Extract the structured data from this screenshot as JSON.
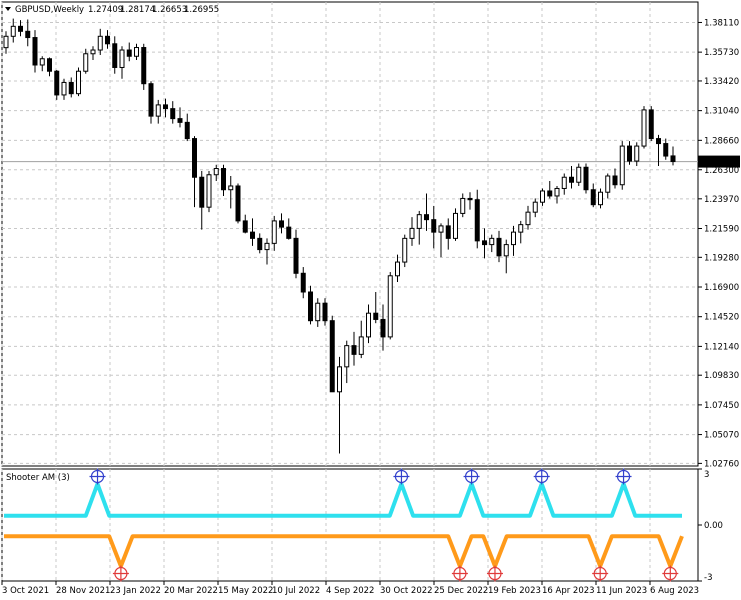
{
  "chart_data": [
    {
      "type": "candlestick",
      "title": "GBPUSD,Weekly",
      "ohlc_header": [
        "1.27409",
        "1.28174",
        "1.26653",
        "1.26955"
      ],
      "current_price_label": "1.26955",
      "current_price": 1.26955,
      "ylim": [
        1.0255,
        1.3975
      ],
      "y_tick_labels": [
        "1.38110",
        "1.35730",
        "1.33420",
        "1.31040",
        "1.28660",
        "1.26300",
        "1.23970",
        "1.21590",
        "1.19280",
        "1.16900",
        "1.14520",
        "1.12140",
        "1.09830",
        "1.07450",
        "1.05070",
        "1.02760"
      ],
      "x_tick_labels": [
        "3 Oct 2021",
        "28 Nov 2021",
        "23 Jan 2022",
        "20 Mar 2022",
        "15 May 2022",
        "10 Jul 2022",
        "4 Sep 2022",
        "30 Oct 2022",
        "25 Dec 2022",
        "19 Feb 2023",
        "16 Apr 2023",
        "11 Jun 2023",
        "6 Aug 2023"
      ],
      "grid": true,
      "colors": {
        "bull_body": "#ffffff",
        "bear_body": "#000000",
        "wick": "#000000",
        "grid": "#c8c8c8",
        "price_line": "#a0a0a0"
      },
      "candles": [
        [
          1.3609,
          1.374,
          1.356,
          1.37
        ],
        [
          1.37,
          1.3842,
          1.365,
          1.378
        ],
        [
          1.378,
          1.383,
          1.37,
          1.374
        ],
        [
          1.374,
          1.3835,
          1.362,
          1.369
        ],
        [
          1.369,
          1.375,
          1.341,
          1.347
        ],
        [
          1.347,
          1.354,
          1.342,
          1.352
        ],
        [
          1.352,
          1.353,
          1.338,
          1.342
        ],
        [
          1.342,
          1.343,
          1.319,
          1.323
        ],
        [
          1.323,
          1.336,
          1.319,
          1.333
        ],
        [
          1.333,
          1.337,
          1.321,
          1.324
        ],
        [
          1.324,
          1.345,
          1.322,
          1.342
        ],
        [
          1.342,
          1.36,
          1.34,
          1.356
        ],
        [
          1.356,
          1.362,
          1.351,
          1.359
        ],
        [
          1.359,
          1.376,
          1.355,
          1.37
        ],
        [
          1.37,
          1.375,
          1.36,
          1.364
        ],
        [
          1.364,
          1.37,
          1.34,
          1.345
        ],
        [
          1.345,
          1.362,
          1.336,
          1.359
        ],
        [
          1.359,
          1.365,
          1.35,
          1.354
        ],
        [
          1.354,
          1.364,
          1.351,
          1.361
        ],
        [
          1.361,
          1.364,
          1.327,
          1.332
        ],
        [
          1.332,
          1.334,
          1.3,
          1.306
        ],
        [
          1.306,
          1.319,
          1.3,
          1.315
        ],
        [
          1.315,
          1.32,
          1.305,
          1.312
        ],
        [
          1.312,
          1.318,
          1.3,
          1.304
        ],
        [
          1.304,
          1.313,
          1.297,
          1.301
        ],
        [
          1.301,
          1.308,
          1.286,
          1.288
        ],
        [
          1.288,
          1.29,
          1.233,
          1.257
        ],
        [
          1.257,
          1.262,
          1.215,
          1.233
        ],
        [
          1.233,
          1.262,
          1.229,
          1.259
        ],
        [
          1.259,
          1.267,
          1.254,
          1.264
        ],
        [
          1.264,
          1.267,
          1.242,
          1.247
        ],
        [
          1.247,
          1.258,
          1.232,
          1.25
        ],
        [
          1.25,
          1.252,
          1.22,
          1.222
        ],
        [
          1.222,
          1.227,
          1.212,
          1.213
        ],
        [
          1.213,
          1.224,
          1.202,
          1.208
        ],
        [
          1.208,
          1.212,
          1.196,
          1.199
        ],
        [
          1.199,
          1.208,
          1.187,
          1.204
        ],
        [
          1.204,
          1.226,
          1.198,
          1.222
        ],
        [
          1.222,
          1.228,
          1.212,
          1.217
        ],
        [
          1.217,
          1.224,
          1.207,
          1.208
        ],
        [
          1.208,
          1.215,
          1.176,
          1.18
        ],
        [
          1.18,
          1.185,
          1.16,
          1.165
        ],
        [
          1.165,
          1.17,
          1.139,
          1.142
        ],
        [
          1.142,
          1.16,
          1.137,
          1.156
        ],
        [
          1.156,
          1.16,
          1.138,
          1.142
        ],
        [
          1.142,
          1.146,
          1.108,
          1.085
        ],
        [
          1.085,
          1.113,
          1.0355,
          1.105
        ],
        [
          1.105,
          1.126,
          1.092,
          1.122
        ],
        [
          1.122,
          1.133,
          1.106,
          1.115
        ],
        [
          1.115,
          1.142,
          1.112,
          1.129
        ],
        [
          1.129,
          1.155,
          1.124,
          1.148
        ],
        [
          1.148,
          1.165,
          1.14,
          1.143
        ],
        [
          1.143,
          1.155,
          1.118,
          1.129
        ],
        [
          1.129,
          1.181,
          1.127,
          1.178
        ],
        [
          1.178,
          1.195,
          1.173,
          1.189
        ],
        [
          1.189,
          1.211,
          1.185,
          1.208
        ],
        [
          1.208,
          1.225,
          1.202,
          1.216
        ],
        [
          1.216,
          1.23,
          1.203,
          1.227
        ],
        [
          1.227,
          1.244,
          1.214,
          1.223
        ],
        [
          1.223,
          1.234,
          1.2,
          1.213
        ],
        [
          1.213,
          1.22,
          1.193,
          1.218
        ],
        [
          1.218,
          1.224,
          1.199,
          1.208
        ],
        [
          1.208,
          1.232,
          1.206,
          1.228
        ],
        [
          1.228,
          1.244,
          1.225,
          1.24
        ],
        [
          1.24,
          1.245,
          1.231,
          1.239
        ],
        [
          1.239,
          1.247,
          1.2,
          1.206
        ],
        [
          1.206,
          1.216,
          1.192,
          1.203
        ],
        [
          1.203,
          1.211,
          1.197,
          1.208
        ],
        [
          1.208,
          1.214,
          1.189,
          1.194
        ],
        [
          1.194,
          1.207,
          1.18,
          1.203
        ],
        [
          1.203,
          1.218,
          1.194,
          1.213
        ],
        [
          1.213,
          1.222,
          1.204,
          1.219
        ],
        [
          1.219,
          1.234,
          1.215,
          1.229
        ],
        [
          1.229,
          1.24,
          1.225,
          1.237
        ],
        [
          1.237,
          1.248,
          1.234,
          1.246
        ],
        [
          1.246,
          1.254,
          1.24,
          1.242
        ],
        [
          1.242,
          1.25,
          1.236,
          1.248
        ],
        [
          1.248,
          1.26,
          1.243,
          1.257
        ],
        [
          1.257,
          1.266,
          1.248,
          1.253
        ],
        [
          1.253,
          1.268,
          1.25,
          1.265
        ],
        [
          1.265,
          1.268,
          1.244,
          1.247
        ],
        [
          1.247,
          1.252,
          1.233,
          1.235
        ],
        [
          1.235,
          1.248,
          1.232,
          1.245
        ],
        [
          1.245,
          1.26,
          1.24,
          1.258
        ],
        [
          1.258,
          1.264,
          1.248,
          1.251
        ],
        [
          1.251,
          1.286,
          1.247,
          1.282
        ],
        [
          1.282,
          1.286,
          1.267,
          1.27
        ],
        [
          1.27,
          1.285,
          1.266,
          1.282
        ],
        [
          1.282,
          1.314,
          1.28,
          1.311
        ],
        [
          1.311,
          1.314,
          1.286,
          1.288
        ],
        [
          1.288,
          1.291,
          1.266,
          1.284
        ],
        [
          1.284,
          1.288,
          1.271,
          1.274
        ],
        [
          1.2741,
          1.2817,
          1.2665,
          1.2696
        ]
      ]
    },
    {
      "type": "line",
      "title": "Shooter AM (3)",
      "ylim": [
        -3,
        3
      ],
      "y_tick_labels": [
        "3",
        "0.00",
        "-3"
      ],
      "colors": {
        "upper": "#2ee0ee",
        "lower": "#ff9a1a",
        "up_marker": "#3340cc",
        "down_marker": "#e03a3a"
      },
      "baseline_upper": 0.5,
      "baseline_lower": -0.6,
      "up_signals": [
        8,
        34,
        40,
        46,
        53
      ],
      "down_signals": [
        10,
        39,
        42,
        51,
        57
      ],
      "series_count": 59
    }
  ]
}
